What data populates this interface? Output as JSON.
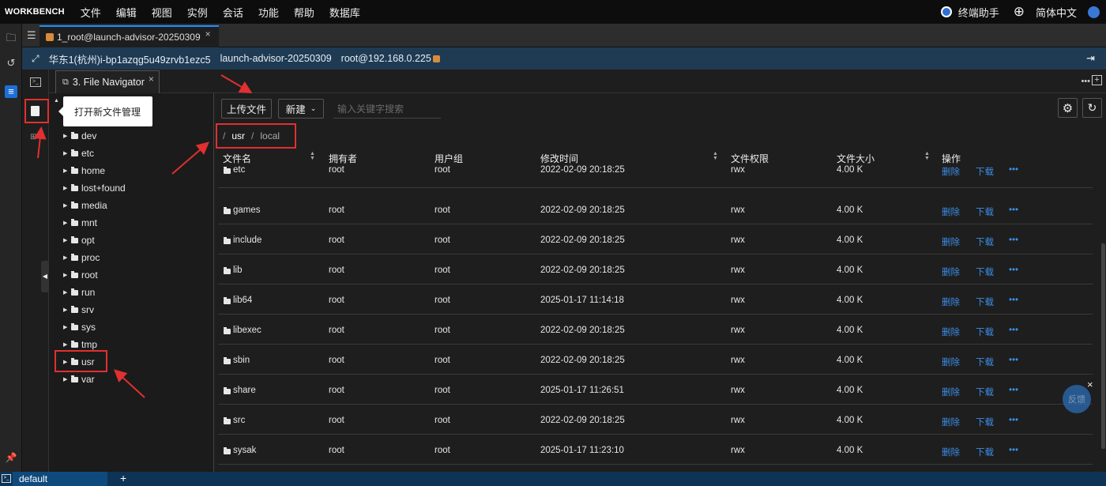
{
  "app": {
    "brand": "WORKBENCH",
    "menu": [
      "文件",
      "编辑",
      "视图",
      "实例",
      "会话",
      "功能",
      "帮助",
      "数据库"
    ],
    "assistant_label": "终端助手",
    "language": "简体中文"
  },
  "tabs": {
    "main_tab_title": "1_root@launch-advisor-20250309",
    "close": "×"
  },
  "session": {
    "region_instance": "华东1(杭州)i-bp1azqg5u49zrvb1ezc5",
    "instance_name": "launch-advisor-20250309",
    "user_host": "root@192.168.0.225"
  },
  "file_nav": {
    "tab_title": "3. File Navigator",
    "tooltip": "打开新文件管理",
    "tree": [
      "dev",
      "etc",
      "home",
      "lost+found",
      "media",
      "mnt",
      "opt",
      "proc",
      "root",
      "run",
      "srv",
      "sys",
      "tmp",
      "usr",
      "var"
    ],
    "toolbar": {
      "upload": "上传文件",
      "new": "新建",
      "search_placeholder": "输入关键字搜索"
    },
    "breadcrumb": [
      "/",
      "usr",
      "/",
      "local"
    ],
    "columns": [
      "文件名",
      "拥有者",
      "用户组",
      "修改时间",
      "文件权限",
      "文件大小",
      "操作"
    ],
    "actions": {
      "delete": "删除",
      "download": "下载",
      "more": "•••"
    },
    "rows": [
      {
        "name": "etc",
        "owner": "root",
        "group": "root",
        "mtime": "2022-02-09 20:18:25",
        "perm": "rwx",
        "size": "4.00 K"
      },
      {
        "name": "games",
        "owner": "root",
        "group": "root",
        "mtime": "2022-02-09 20:18:25",
        "perm": "rwx",
        "size": "4.00 K"
      },
      {
        "name": "include",
        "owner": "root",
        "group": "root",
        "mtime": "2022-02-09 20:18:25",
        "perm": "rwx",
        "size": "4.00 K"
      },
      {
        "name": "lib",
        "owner": "root",
        "group": "root",
        "mtime": "2022-02-09 20:18:25",
        "perm": "rwx",
        "size": "4.00 K"
      },
      {
        "name": "lib64",
        "owner": "root",
        "group": "root",
        "mtime": "2025-01-17 11:14:18",
        "perm": "rwx",
        "size": "4.00 K"
      },
      {
        "name": "libexec",
        "owner": "root",
        "group": "root",
        "mtime": "2022-02-09 20:18:25",
        "perm": "rwx",
        "size": "4.00 K"
      },
      {
        "name": "sbin",
        "owner": "root",
        "group": "root",
        "mtime": "2022-02-09 20:18:25",
        "perm": "rwx",
        "size": "4.00 K"
      },
      {
        "name": "share",
        "owner": "root",
        "group": "root",
        "mtime": "2025-01-17 11:26:51",
        "perm": "rwx",
        "size": "4.00 K"
      },
      {
        "name": "src",
        "owner": "root",
        "group": "root",
        "mtime": "2022-02-09 20:18:25",
        "perm": "rwx",
        "size": "4.00 K"
      },
      {
        "name": "sysak",
        "owner": "root",
        "group": "root",
        "mtime": "2025-01-17 11:23:10",
        "perm": "rwx",
        "size": "4.00 K"
      }
    ],
    "feedback": "反馈"
  },
  "status": {
    "workspace": "default",
    "add": "+"
  },
  "colors": {
    "accent": "#3b8ee8",
    "annotation": "#e03030",
    "infobar": "#1f3a53"
  }
}
